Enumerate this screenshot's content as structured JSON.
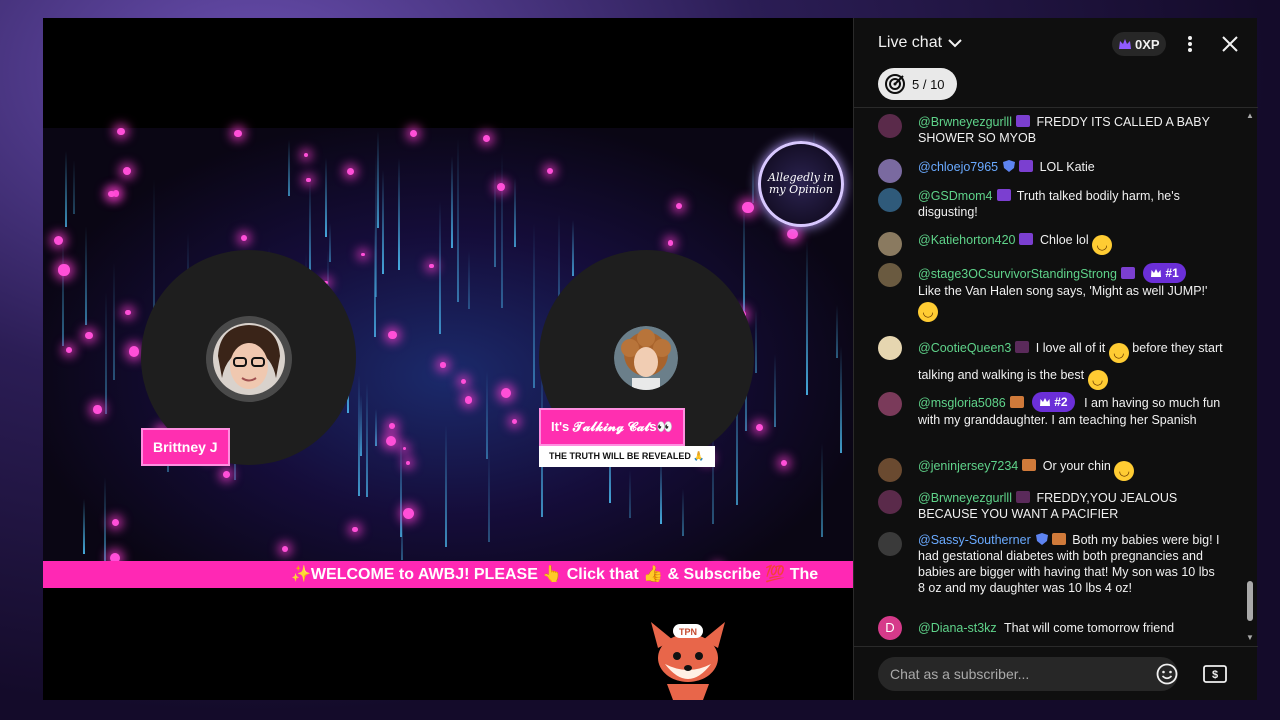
{
  "video": {
    "guest_left_name": "Brittney J",
    "guest_right_name": "It's 𝓣𝓪𝓵𝓴𝓲𝓷𝓰 𝓒𝓪𝓽s👀",
    "guest_right_subtitle": "THE TRUTH WILL BE REVEALED 🙏",
    "ticker": "✨WELCOME to AWBJ! PLEASE 👆 Click that 👍 & Subscribe 💯 The",
    "logo_text": "Allegedly in my Opinion",
    "mascot_badge": "TPN"
  },
  "chat": {
    "title": "Live chat",
    "xp": "0XP",
    "goal": "5 / 10",
    "input_placeholder": "Chat as a subscriber...",
    "messages": [
      {
        "author": "@Brwneyezgurlll",
        "author_color": "green",
        "text": "FREDDY ITS CALLED A BABY SHOWER SO MYOB"
      },
      {
        "author": "@chloejo7965",
        "author_color": "blue",
        "text": "LOL Katie"
      },
      {
        "author": "@GSDmom4",
        "author_color": "green",
        "text": "Truth talked bodily harm, he's disgusting!"
      },
      {
        "author": "@Katiehorton420",
        "author_color": "green",
        "text": "Chloe lol"
      },
      {
        "author": "@stage3OCsurvivorStandingStrong",
        "author_color": "green",
        "rank": "#1",
        "text": "Like the Van Halen song says, 'Might as well JUMP!'"
      },
      {
        "author": "@CootieQueen3",
        "author_color": "green",
        "text_a": "I love all of it",
        "text_b": "before they start talking and walking is the best"
      },
      {
        "author": "@msgloria5086",
        "author_color": "green",
        "rank": "#2",
        "text": "I am having so much fun with my granddaughter. I am teaching her Spanish"
      },
      {
        "author": "@jeninjersey7234",
        "author_color": "green",
        "text": "Or your chin"
      },
      {
        "author": "@Brwneyezgurlll",
        "author_color": "green",
        "text": "FREDDY,YOU JEALOUS BECAUSE YOU WANT A PACIFIER"
      },
      {
        "author": "@Sassy-Southerner",
        "author_color": "blue",
        "text": "Both my babies were big! I had gestational diabetes with both pregnancies and babies are bigger with having that! My son was 10 lbs 8 oz and my daughter was 10 lbs 4 oz!"
      },
      {
        "author": "@Diana-st3kz",
        "author_color": "green",
        "avatar_letter": "D",
        "text": "That will come tomorrow friend"
      }
    ]
  },
  "colors": {
    "accent_pink": "#ff28b4",
    "author_green": "#5fd38a",
    "author_blue": "#6aaaff",
    "rank_purple": "#6b2fd8"
  }
}
